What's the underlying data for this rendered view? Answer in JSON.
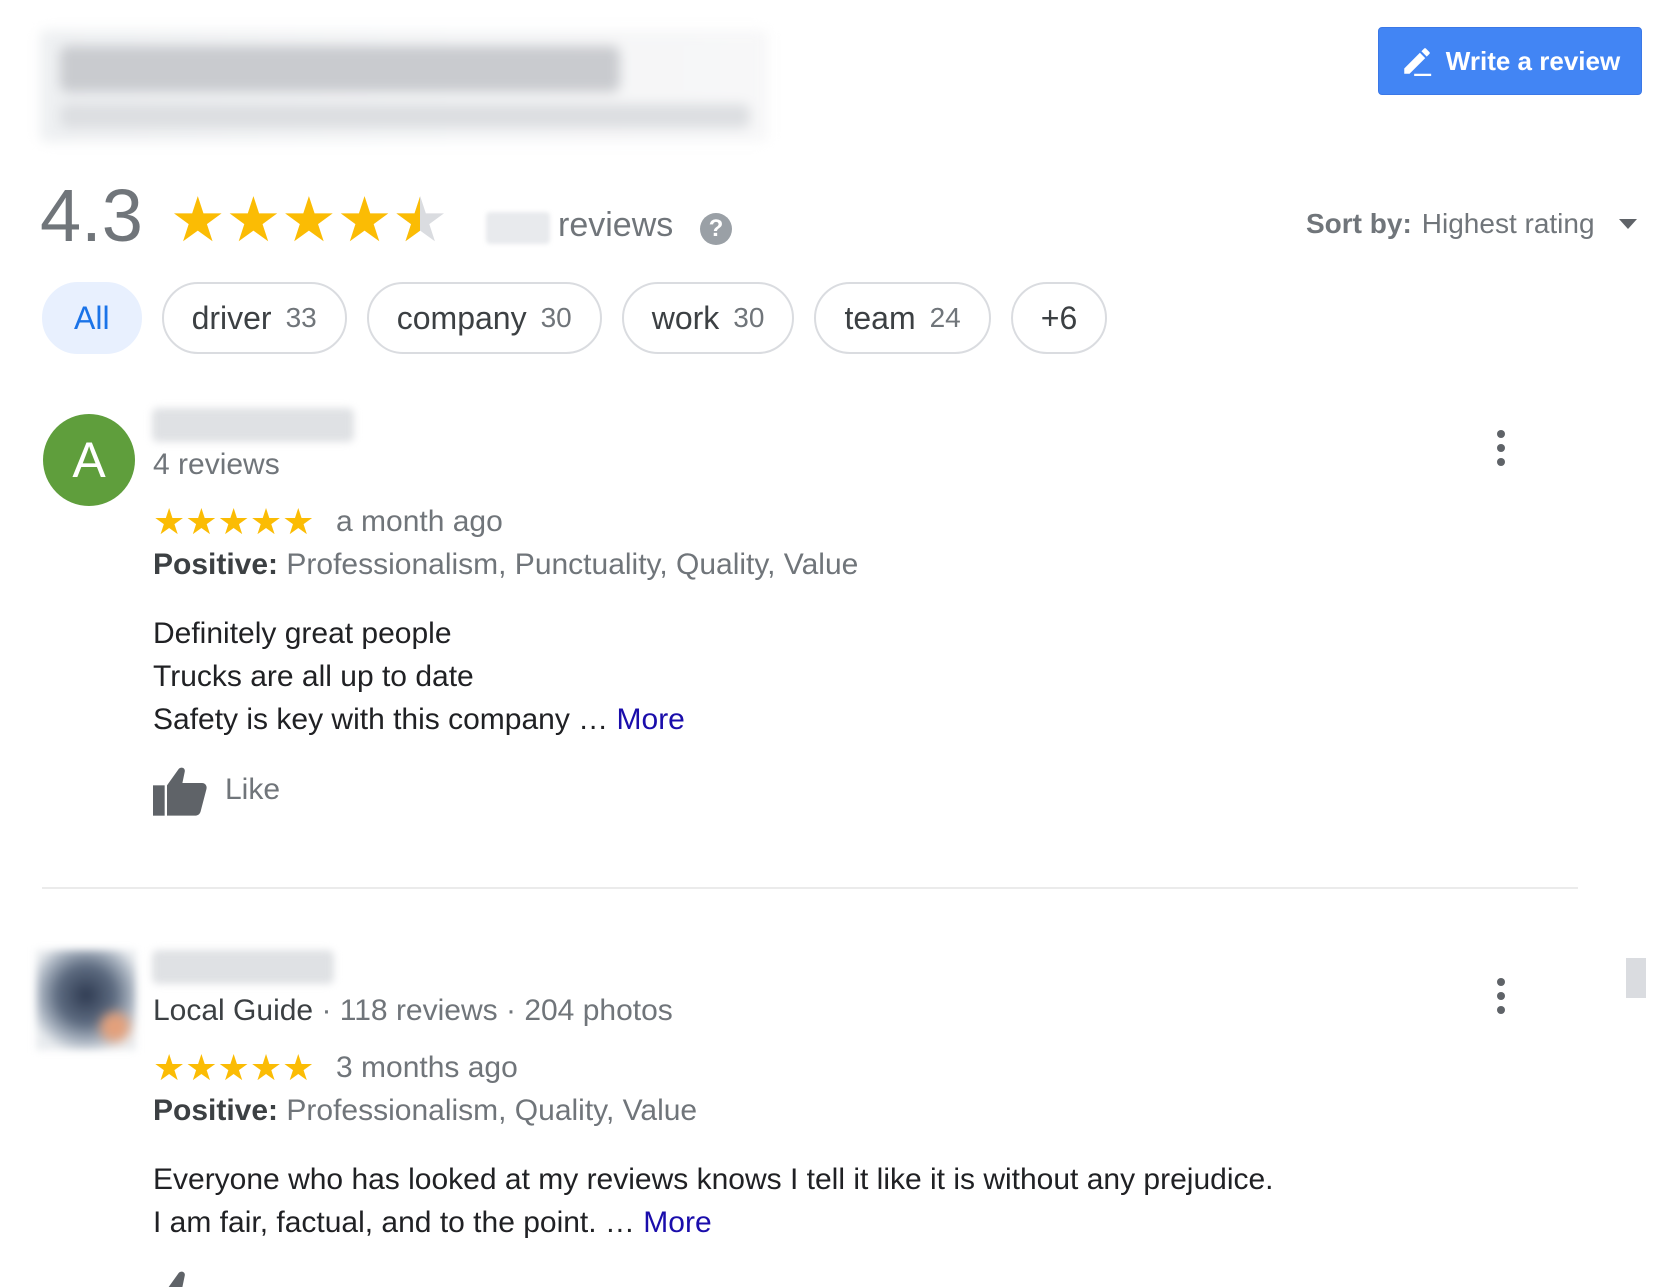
{
  "header": {
    "write_review_label": "Write a review",
    "rating": "4.3",
    "rating_value": 4.3,
    "reviews_label": "reviews",
    "help_glyph": "?",
    "sort_label": "Sort by:",
    "sort_value": "Highest rating"
  },
  "chips": [
    {
      "label": "All",
      "count": ""
    },
    {
      "label": "driver",
      "count": "33"
    },
    {
      "label": "company",
      "count": "30"
    },
    {
      "label": "work",
      "count": "30"
    },
    {
      "label": "team",
      "count": "24"
    },
    {
      "label": "+6",
      "count": ""
    }
  ],
  "reviews": [
    {
      "avatar_letter": "A",
      "avatar_color": "#5f9e3c",
      "meta_reviews": "4 reviews",
      "stars": 5,
      "when": "a month ago",
      "positive_label": "Positive:",
      "positive_text": "Professionalism, Punctuality, Quality, Value",
      "lines": [
        "Definitely great people",
        "Trucks are all up to date",
        "Safety is key with this company …"
      ],
      "more": "More",
      "like_label": "Like"
    },
    {
      "guide_label": "Local Guide",
      "meta_reviews": "118 reviews",
      "meta_photos": "204 photos",
      "stars": 5,
      "when": "3 months ago",
      "positive_label": "Positive:",
      "positive_text": "Professionalism, Quality, Value",
      "lines": [
        "Everyone who has looked at my reviews knows I tell it like it is without any prejudice.",
        "I am fair, factual, and to the point. …"
      ],
      "more": "More"
    }
  ],
  "colors": {
    "accent": "#4285f4",
    "star": "#fbbc04",
    "link": "#1a0dab"
  },
  "icons": {
    "write": "pencil-icon",
    "help": "help-icon",
    "sort": "caret-down-icon",
    "like": "thumbs-up-icon",
    "menu": "more-vert-icon"
  }
}
